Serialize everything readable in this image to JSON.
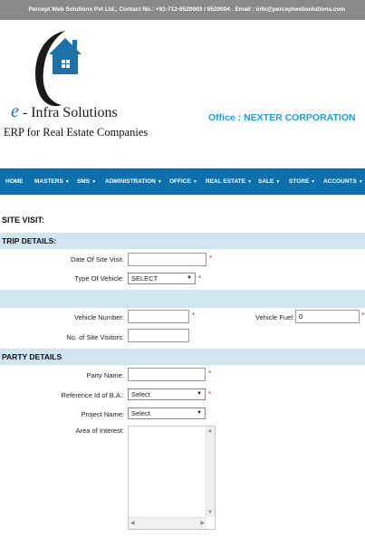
{
  "topbar": {
    "text": "Percept Web Solutions Pvt Ltd., Contact No.: +91-712-6520003 / 6520004 . Email : info@perceptwebsolutions.com"
  },
  "brand": {
    "e": "e",
    "name": " - Infra Solutions",
    "tagline": "ERP for Real Estate Companies",
    "accent": "#1f6fa8"
  },
  "office": "Office : NEXTER CORPORATION",
  "nav": {
    "color": "#0d70ad",
    "items": [
      "HOME",
      "MASTERS",
      "SMS",
      "ADMINISTRATION",
      "OFFICE",
      "REAL ESTATE",
      "SALE",
      "STORE",
      "ACCOUNTS"
    ],
    "caret": "▼"
  },
  "page_heading": "SITE VISIT:",
  "trip": {
    "heading": "TRIP DETAILS:",
    "date_label": "Date Of Site Visit:",
    "date_value": "",
    "vehicle_type_label": "Type Of Vehicle:",
    "vehicle_type_value": "SELECT"
  },
  "vehicle": {
    "number_label": "Vehicle Number:",
    "number_value": "",
    "fuel_label": "Vehicle Fuel:",
    "fuel_value": "0",
    "visitors_label": "No. of Site Visitors:",
    "visitors_value": ""
  },
  "party": {
    "heading": "PARTY DETAILS",
    "name_label": "Party Name:",
    "name_value": "",
    "ref_label": "Reference Id of B.A.:",
    "ref_value": "Select",
    "project_label": "Project Name:",
    "project_value": "Select",
    "interest_label": "Area of Interest:"
  },
  "required_mark": "*",
  "icons": {
    "dropdown": "chevron-down-icon",
    "scroll_up": "▲",
    "scroll_down": "▼",
    "scroll_left": "◀",
    "scroll_right": "▶"
  },
  "required_color": "#d9262a",
  "section_color": "#cfe5f0"
}
